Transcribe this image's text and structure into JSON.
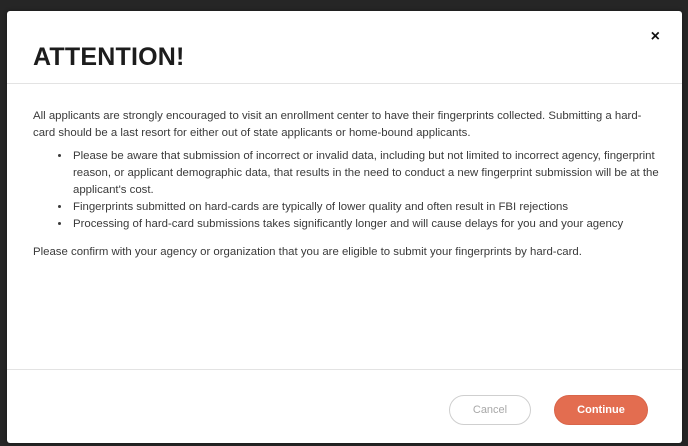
{
  "dialog": {
    "title": "ATTENTION!",
    "close_label": "×",
    "intro": "All applicants are strongly encouraged to visit an enrollment center to have their fingerprints collected. Submitting a hard-card should be a last resort for either out of state applicants or home-bound applicants.",
    "bullets": [
      "Please be aware that submission of incorrect or invalid data, including but not limited to incorrect agency, fingerprint reason, or applicant demographic data, that results in the need to conduct a new fingerprint submission will be at the applicant's cost.",
      "Fingerprints submitted on hard-cards are typically of lower quality and often result in FBI rejections",
      "Processing of hard-card submissions takes significantly longer and will cause delays for you and your agency"
    ],
    "confirm": "Please confirm with your agency or organization that you are eligible to submit your fingerprints by hard-card.",
    "cancel_label": "Cancel",
    "continue_label": "Continue"
  },
  "colors": {
    "backdrop": "#262626",
    "continue_button": "#e36d50",
    "cancel_text": "#a8a8a8"
  }
}
